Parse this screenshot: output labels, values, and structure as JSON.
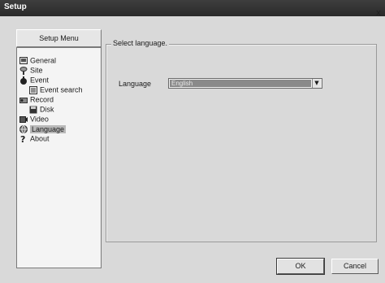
{
  "window": {
    "title": "Setup",
    "close_glyph": "x"
  },
  "sidebar": {
    "menu_button_label": "Setup Menu",
    "items": [
      {
        "label": "General",
        "icon": "general-icon",
        "indent": 0
      },
      {
        "label": "Site",
        "icon": "site-icon",
        "indent": 0
      },
      {
        "label": "Event",
        "icon": "event-icon",
        "indent": 0
      },
      {
        "label": "Event search",
        "icon": "event-search-icon",
        "indent": 1
      },
      {
        "label": "Record",
        "icon": "record-icon",
        "indent": 0
      },
      {
        "label": "Disk",
        "icon": "disk-icon",
        "indent": 1
      },
      {
        "label": "Video",
        "icon": "video-icon",
        "indent": 0
      },
      {
        "label": "Language",
        "icon": "language-icon",
        "indent": 0,
        "selected": true
      },
      {
        "label": "About",
        "icon": "about-icon",
        "indent": 0
      }
    ]
  },
  "main": {
    "group_title": "Select language.",
    "language_label": "Language",
    "language_value": "English"
  },
  "footer": {
    "ok_label": "OK",
    "cancel_label": "Cancel"
  }
}
